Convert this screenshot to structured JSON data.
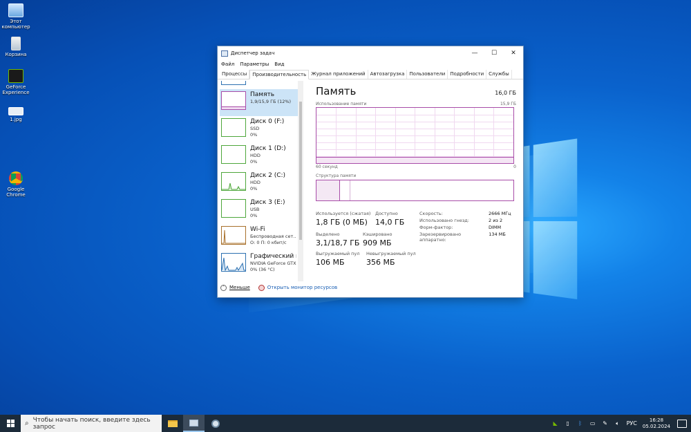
{
  "desktop": {
    "icons": [
      {
        "label": "Этот компьютер"
      },
      {
        "label": "Корзина"
      },
      {
        "label": "GeForce Experience"
      },
      {
        "label": "1.jpg"
      },
      {
        "label": "Google Chrome"
      }
    ]
  },
  "window": {
    "title": "Диспетчер задач",
    "controls": {
      "minimize": "—",
      "maximize": "☐",
      "close": "✕"
    },
    "menu": [
      "Файл",
      "Параметры",
      "Вид"
    ],
    "tabs": [
      "Процессы",
      "Производительность",
      "Журнал приложений",
      "Автозагрузка",
      "Пользователи",
      "Подробности",
      "Службы"
    ],
    "active_tab": "Производительность"
  },
  "sidebar": {
    "items": [
      {
        "name": "Память",
        "line1": "1,9/15,9 ГБ (12%)",
        "line2": "",
        "color": "#a84ca8"
      },
      {
        "name": "Диск 0 (F:)",
        "line1": "SSD",
        "line2": "0%",
        "color": "#4da63a"
      },
      {
        "name": "Диск 1 (D:)",
        "line1": "HDD",
        "line2": "0%",
        "color": "#4da63a"
      },
      {
        "name": "Диск 2 (C:)",
        "line1": "HDD",
        "line2": "0%",
        "color": "#4da63a"
      },
      {
        "name": "Диск 3 (E:)",
        "line1": "USB",
        "line2": "0%",
        "color": "#4da63a"
      },
      {
        "name": "Wi-Fi",
        "line1": "Беспроводная сет...",
        "line2": "О: 0 П: 0 кбит/с",
        "color": "#a8702a"
      },
      {
        "name": "Графический пр",
        "line1": "NVIDIA GeForce GTX",
        "line2": "0% (36 °C)",
        "color": "#2a6fb0"
      }
    ]
  },
  "footer": {
    "less_label": "Меньше",
    "resmon_label": "Открыть монитор ресурсов"
  },
  "memory": {
    "title": "Память",
    "total": "16,0 ГБ",
    "usage_label": "Использование памяти",
    "usage_max": "15,9 ГБ",
    "axis_left": "60 секунд",
    "axis_right": "0",
    "structure_label": "Структура памяти",
    "stats": {
      "in_use_label": "Используется (сжатая)",
      "in_use_value": "1,8 ГБ (0 МБ)",
      "available_label": "Доступно",
      "available_value": "14,0 ГБ",
      "committed_label": "Выделено",
      "committed_value": "3,1/18,7 ГБ",
      "cached_label": "Кэшировано",
      "cached_value": "909 МБ",
      "paged_label": "Выгружаемый пул",
      "paged_value": "106 МБ",
      "nonpaged_label": "Невыгружаемый пул",
      "nonpaged_value": "356 МБ"
    },
    "specs": [
      {
        "k": "Скорость:",
        "v": "2666 МГц"
      },
      {
        "k": "Использовано гнезд:",
        "v": "2 из 2"
      },
      {
        "k": "Форм-фактор:",
        "v": "DIMM"
      },
      {
        "k": "Зарезервировано аппаратно:",
        "v": "134 МБ"
      }
    ]
  },
  "taskbar": {
    "search_placeholder": "Чтобы начать поиск, введите здесь запрос",
    "lang": "РУС",
    "time": "16:28",
    "date": "05.02.2024"
  }
}
